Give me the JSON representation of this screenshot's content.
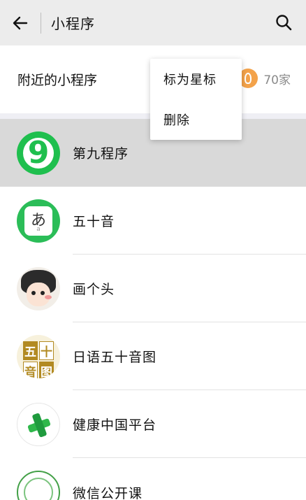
{
  "header": {
    "title": "小程序",
    "back_icon": "arrow-left-icon",
    "search_icon": "search-icon"
  },
  "nearby": {
    "label": "附近的小程序",
    "count": "70家",
    "icon": "nearby-location-icon"
  },
  "context_menu": {
    "items": [
      {
        "label": "标为星标"
      },
      {
        "label": "删除"
      }
    ]
  },
  "apps": [
    {
      "name": "第九程序",
      "selected": true,
      "icon_text": "9"
    },
    {
      "name": "五十音",
      "icon_text": "あ",
      "icon_subtext": "a"
    },
    {
      "name": "画个头"
    },
    {
      "name": "日语五十音图",
      "icon_cells": [
        "五",
        "十",
        "音",
        "图"
      ]
    },
    {
      "name": "健康中国平台"
    },
    {
      "name": "微信公开课"
    }
  ],
  "colors": {
    "accent_green": "#1fbf4e",
    "header_bg": "#ececec",
    "selected_row": "#d9d9d9",
    "nearby_badge": "#f3a24a"
  }
}
